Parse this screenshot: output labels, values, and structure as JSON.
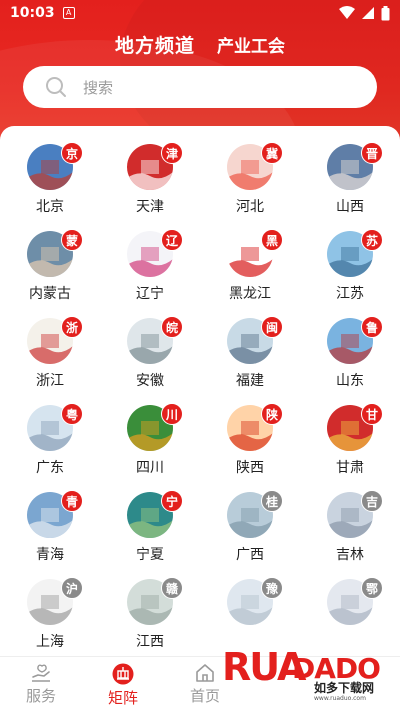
{
  "status_bar": {
    "time": "10:03",
    "notif_glyph": "A"
  },
  "header": {
    "title": "地方频道",
    "subtitle": "产业工会",
    "color": "#e3201d"
  },
  "search": {
    "placeholder": "搜索"
  },
  "regions": [
    {
      "name": "北京",
      "badge": "京",
      "badge_color": "#e3201d"
    },
    {
      "name": "天津",
      "badge": "津",
      "badge_color": "#e3201d"
    },
    {
      "name": "河北",
      "badge": "冀",
      "badge_color": "#e3201d"
    },
    {
      "name": "山西",
      "badge": "晋",
      "badge_color": "#e3201d"
    },
    {
      "name": "内蒙古",
      "badge": "蒙",
      "badge_color": "#e3201d"
    },
    {
      "name": "辽宁",
      "badge": "辽",
      "badge_color": "#e3201d"
    },
    {
      "name": "黑龙江",
      "badge": "黑",
      "badge_color": "#e3201d"
    },
    {
      "name": "江苏",
      "badge": "苏",
      "badge_color": "#e3201d"
    },
    {
      "name": "浙江",
      "badge": "浙",
      "badge_color": "#e3201d"
    },
    {
      "name": "安徽",
      "badge": "皖",
      "badge_color": "#e3201d"
    },
    {
      "name": "福建",
      "badge": "闽",
      "badge_color": "#e3201d"
    },
    {
      "name": "山东",
      "badge": "鲁",
      "badge_color": "#e3201d"
    },
    {
      "name": "广东",
      "badge": "粤",
      "badge_color": "#e3201d"
    },
    {
      "name": "四川",
      "badge": "川",
      "badge_color": "#e3201d"
    },
    {
      "name": "陕西",
      "badge": "陕",
      "badge_color": "#e3201d"
    },
    {
      "name": "甘肃",
      "badge": "甘",
      "badge_color": "#e3201d"
    },
    {
      "name": "青海",
      "badge": "青",
      "badge_color": "#e3201d"
    },
    {
      "name": "宁夏",
      "badge": "宁",
      "badge_color": "#e3201d"
    },
    {
      "name": "广西",
      "badge": "桂",
      "badge_color": "#8a8a8a"
    },
    {
      "name": "吉林",
      "badge": "吉",
      "badge_color": "#8a8a8a"
    },
    {
      "name": "上海",
      "badge": "沪",
      "badge_color": "#8a8a8a"
    },
    {
      "name": "江西",
      "badge": "赣",
      "badge_color": "#8a8a8a"
    },
    {
      "name": "",
      "badge": "豫",
      "badge_color": "#8a8a8a"
    },
    {
      "name": "",
      "badge": "鄂",
      "badge_color": "#8a8a8a"
    }
  ],
  "tabbar": {
    "items": [
      {
        "label": "服务",
        "icon": "service-icon",
        "active": false
      },
      {
        "label": "矩阵",
        "icon": "matrix-icon",
        "active": true
      },
      {
        "label": "首页",
        "icon": "home-icon",
        "active": false
      }
    ]
  },
  "watermark": {
    "logo": "RUADADO",
    "sub": "如多下载网",
    "url": "www.ruaduo.com"
  }
}
